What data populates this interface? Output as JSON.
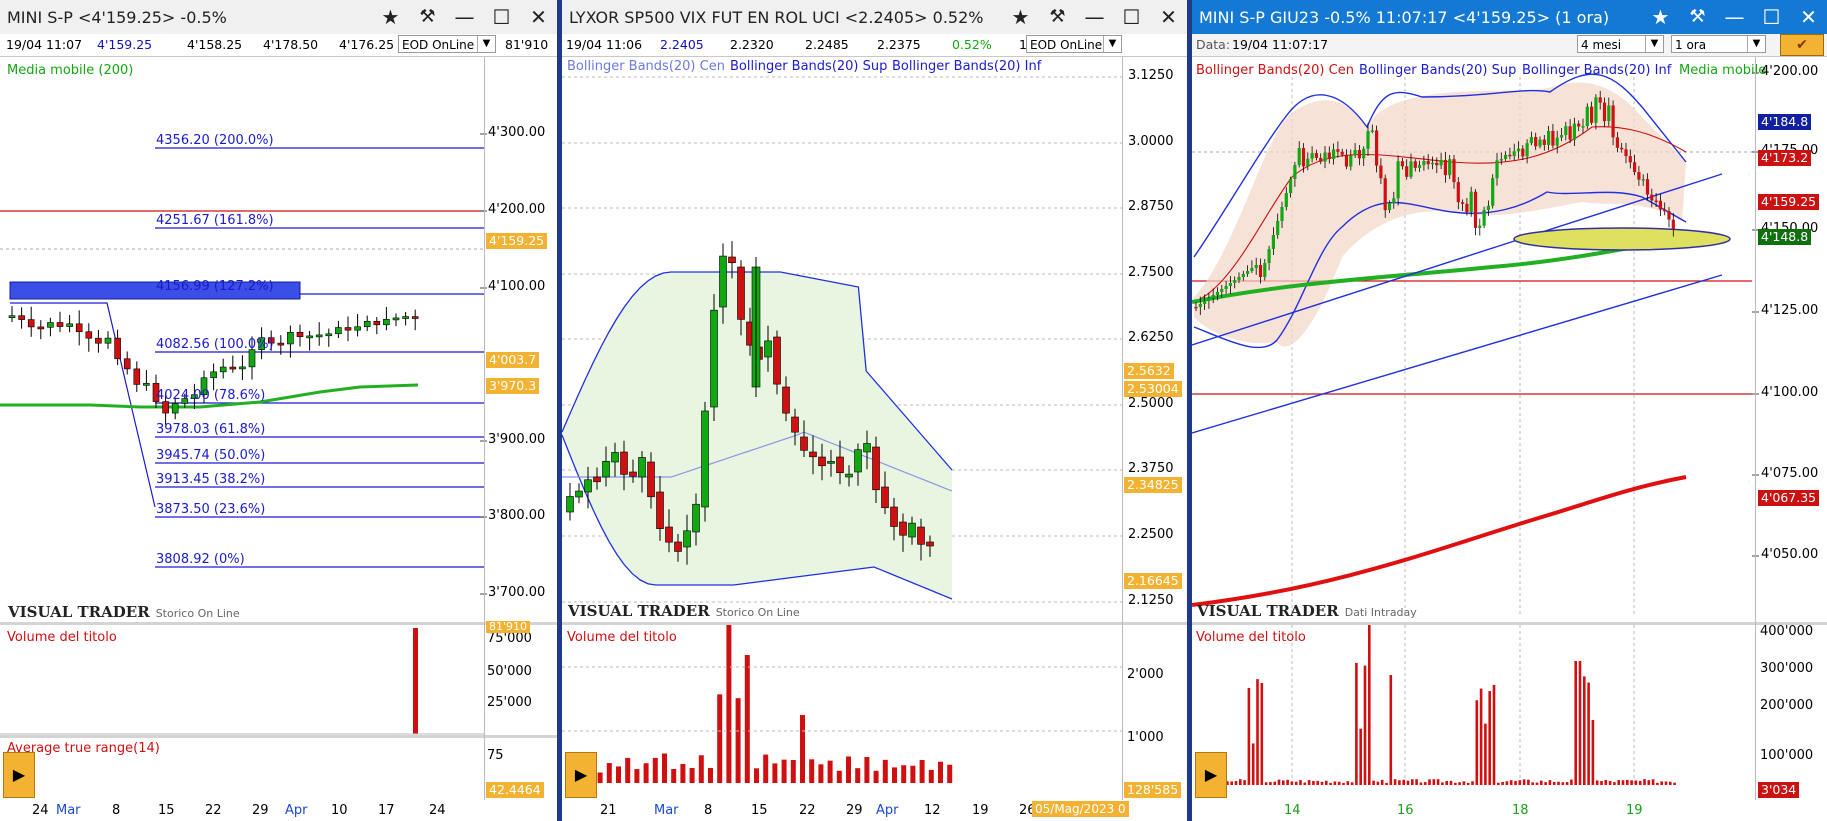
{
  "panels": [
    {
      "title": "MINI S-P <4'159.25> -0.5%",
      "info": [
        "19/04 11:07",
        "4'159.25",
        "4'158.25",
        "4'178.50",
        "4'176.25"
      ],
      "mode_select": "EOD OnLine",
      "volume_value": "81'910",
      "indicator_top": "Media mobile (200)",
      "fib_levels": [
        "4356.20 (200.0%)",
        "4251.67 (161.8%)",
        "4156.99 (127.2%)",
        "4082.56 (100.0%)",
        "4024.00 (78.6%)",
        "3978.03 (61.8%)",
        "3945.74 (50.0%)",
        "3913.45 (38.2%)",
        "3873.50 (23.6%)",
        "3808.92 (0%)"
      ],
      "price_axis": [
        "4'300.00",
        "4'200.00",
        "4'100.00",
        "3'900.00",
        "3'800.00",
        "3'700.00"
      ],
      "tags": {
        "last": "4'159.25",
        "t2": "4'003.7",
        "t3": "3'970.3"
      },
      "brand": "VISUAL TRADER",
      "brand_sub": "Storico On Line",
      "volume_title": "Volume del titolo",
      "volume_axis": [
        "75'000",
        "50'000",
        "25'000"
      ],
      "volume_tag": "81'910",
      "atr_title": "Average true range(14)",
      "atr_axis": "75",
      "atr_tag": "42.4464",
      "x_axis": [
        "24",
        "Mar",
        "8",
        "15",
        "22",
        "29",
        "Apr",
        "10",
        "17",
        "24"
      ]
    },
    {
      "title": "LYXOR SP500 VIX FUT EN ROL UCI <2.2405> 0.52%",
      "info": [
        "19/04 11:06",
        "2.2405",
        "2.2320",
        "2.2485",
        "2.2375",
        "0.52%",
        "1"
      ],
      "mode_select": "EOD OnLine",
      "legend": [
        "Bollinger Bands(20) Cen",
        "Bollinger Bands(20) Sup",
        "Bollinger Bands(20) Inf"
      ],
      "price_axis": [
        "3.1250",
        "3.0000",
        "2.8750",
        "2.7500",
        "2.6250",
        "2.5000",
        "2.3750",
        "2.2500",
        "2.1250"
      ],
      "tags": {
        "t1": "2.5632",
        "t2": "2.53004",
        "t3": "2.34825",
        "t4": "2.16645"
      },
      "brand": "VISUAL TRADER",
      "brand_sub": "Storico On Line",
      "volume_title": "Volume del titolo",
      "volume_axis": [
        "2'000",
        "1'000"
      ],
      "volume_tag": "128'585",
      "x_axis": [
        "21",
        "Mar",
        "8",
        "15",
        "22",
        "29",
        "Apr",
        "12",
        "19",
        "26"
      ],
      "date_tag": "05/Mag/2023 0"
    },
    {
      "title": "MINI S-P GIU23 -0.5% 11:07:17 <4'159.25> (1 ora)",
      "info_label": "Data:",
      "info_value": "19/04 11:07:17",
      "period_select": "4 mesi",
      "interval_select": "1 ora",
      "legend": [
        "Bollinger Bands(20) Cen",
        "Bollinger Bands(20) Sup",
        "Bollinger Bands(20) Inf",
        "Media mobile"
      ],
      "price_axis": [
        "4'200.00",
        "4'175.00",
        "4'150.00",
        "4'125.00",
        "4'100.00",
        "4'075.00",
        "4'050.00"
      ],
      "tags": {
        "t1": "4'184.8",
        "t2": "4'173.2",
        "last": "4'159.25",
        "t4": "4'148.8",
        "t5": "4'067.35"
      },
      "brand": "VISUAL TRADER",
      "brand_sub": "Dati Intraday",
      "volume_title": "Volume del titolo",
      "volume_axis": [
        "400'000",
        "300'000",
        "200'000",
        "100'000"
      ],
      "volume_tag": "3'034",
      "x_axis": [
        "14",
        "16",
        "18",
        "19"
      ]
    }
  ],
  "colors": {
    "bull": "#11a811",
    "bear": "#d01010",
    "fib": "#1a1ad0",
    "ma": "#22b022",
    "title_active": "#1479d4",
    "accent": "#f3b232"
  }
}
